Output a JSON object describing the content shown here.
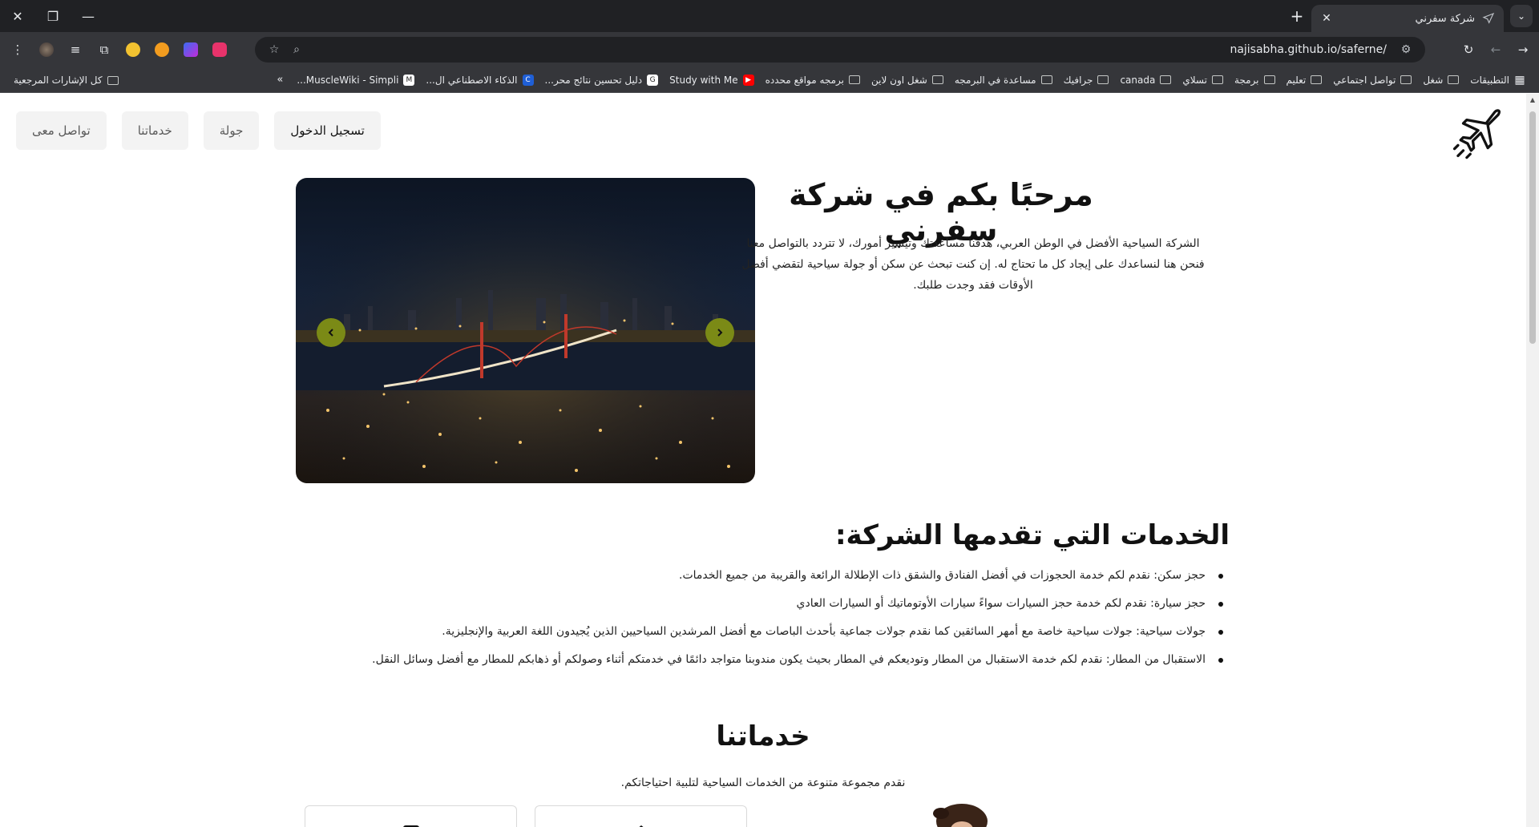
{
  "browser": {
    "tab_title": "شركة سفرني",
    "url": "najisabha.github.io/saferne/",
    "bookmarks": [
      {
        "label": "التطبيقات",
        "icon": "apps-grid-icon"
      },
      {
        "label": "شغل",
        "icon": "folder-icon"
      },
      {
        "label": "تواصل اجتماعي",
        "icon": "folder-icon"
      },
      {
        "label": "تعليم",
        "icon": "folder-icon"
      },
      {
        "label": "برمجة",
        "icon": "folder-icon"
      },
      {
        "label": "تسلاي",
        "icon": "folder-icon"
      },
      {
        "label": "canada",
        "icon": "folder-icon"
      },
      {
        "label": "جرافيك",
        "icon": "folder-icon"
      },
      {
        "label": "مساعدة في البرمجه",
        "icon": "folder-icon"
      },
      {
        "label": "شغل اون لاين",
        "icon": "folder-icon"
      },
      {
        "label": "برمجه مواقع محدده",
        "icon": "folder-icon"
      },
      {
        "label": "Study with Me",
        "icon": "youtube-icon"
      },
      {
        "label": "دليل تحسين نتائج محر...",
        "icon": "google-icon"
      },
      {
        "label": "الذكاء الاصطناعي ال...",
        "icon": "c-logo-icon"
      },
      {
        "label": "MuscleWiki - Simpli...",
        "icon": "musclewiki-icon"
      }
    ],
    "all_bookmarks": "كل الإشارات المرجعية",
    "more_bookmarks": "»"
  },
  "nav": {
    "login": "تسجيل الدخول",
    "tour": "جولة",
    "services": "خدماتنا",
    "contact": "تواصل معى"
  },
  "hero": {
    "title": "مرحبًا بكم في شركة سفرني",
    "intro": "الشركة السياحية الأفضل في الوطن العربي، هدفنا مساعدتك وتيسير أمورك، لا تتردد بالتواصل معنا فنحن هنا لنساعدك على إيجاد كل ما تحتاج له. إن كنت تبحث عن سكن أو جولة سياحية لتقضي أفضل الأوقات فقد وجدت طلبك.",
    "prev_icon": "chevron-left-icon",
    "next_icon": "chevron-right-icon"
  },
  "services": {
    "title": "الخدمات التي تقدمها الشركة:",
    "items": [
      "حجز سكن: نقدم لكم خدمة الحجوزات في أفضل الفنادق والشقق ذات الإطلالة الرائعة والقريبة من جميع الخدمات.",
      "حجز سيارة: نقدم لكم خدمة حجز السيارات سواءً سيارات الأوتوماتيك أو السيارات العادي",
      "جولات سياحية: جولات سياحية خاصة مع أمهر السائقين كما نقدم جولات جماعية بأحدث الباصات مع أفضل المرشدين السياحيين الذين يُجيدون اللغة العربية والإنجليزية.",
      "الاستقبال من المطار: نقدم لكم خدمة الاستقبال من المطار وتوديعكم في المطار بحيث يكون مندوبنا متواجد دائمًا في خدمتكم أثناء وصولكم أو ذهابكم للمطار مع أفضل وسائل النقل."
    ]
  },
  "ours": {
    "title": "خدماتنا",
    "subtitle": "نقدم مجموعة متنوعة من الخدمات السياحية لتلبية احتياجاتكم."
  },
  "colors": {
    "chrome_dark": "#202124",
    "chrome_toolbar": "#35363a",
    "carousel_button": "#7b8a16"
  }
}
